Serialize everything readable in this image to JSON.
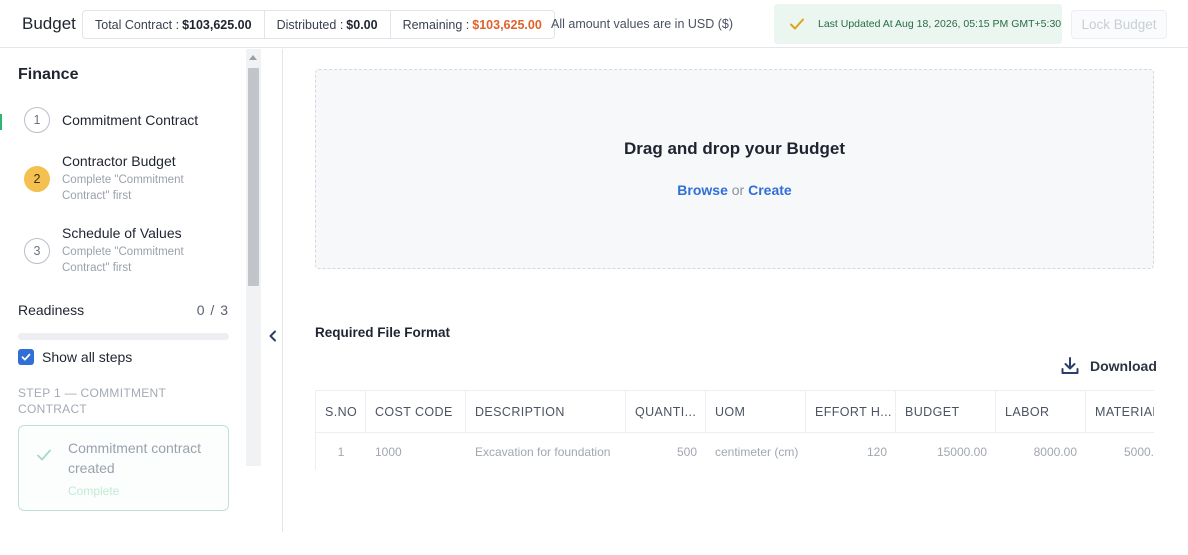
{
  "header": {
    "title": "Budget",
    "summary": [
      {
        "label": "Total Contract :",
        "value": "$103,625.00"
      },
      {
        "label": "Distributed :",
        "value": "$0.00"
      },
      {
        "label": "Remaining :",
        "value": "$103,625.00"
      }
    ],
    "currency_note": "All amount values are in USD ($)",
    "last_updated": "Last Updated At Aug 18, 2026, 05:15 PM GMT+5:30",
    "lock_button": "Lock Budget"
  },
  "sidebar": {
    "heading": "Finance",
    "steps": [
      {
        "number": "1",
        "title": "Commitment Contract",
        "subtitle": ""
      },
      {
        "number": "2",
        "title": "Contractor Budget",
        "subtitle": "Complete \"Commitment Contract\" first"
      },
      {
        "number": "3",
        "title": "Schedule of Values",
        "subtitle": "Complete \"Commitment Contract\" first"
      }
    ],
    "readiness_label": "Readiness",
    "readiness_count": "0 / 3",
    "readiness_progress": 0,
    "show_all_steps": "Show all steps",
    "step_caption": "STEP 1 — COMMITMENT CONTRACT",
    "step_card": {
      "title": "Commitment contract created",
      "status": "Complete"
    }
  },
  "main": {
    "dropzone_title": "Drag and drop your Budget",
    "browse": "Browse",
    "or": "or",
    "create": "Create",
    "required_format": "Required File Format",
    "download": "Download",
    "table": {
      "columns": [
        "S.NO",
        "COST CODE",
        "DESCRIPTION",
        "QUANTI...",
        "UOM",
        "EFFORT H...",
        "BUDGET",
        "LABOR",
        "MATERIAL"
      ],
      "rows": [
        [
          "1",
          "1000",
          "Excavation for foundation",
          "500",
          "centimeter (cm)",
          "120",
          "15000.00",
          "8000.00",
          "5000."
        ]
      ]
    }
  },
  "colors": {
    "accent": "#2f6fd6",
    "warning": "#e0622a",
    "success": "#2bb673",
    "active_step": "#f4c150"
  }
}
